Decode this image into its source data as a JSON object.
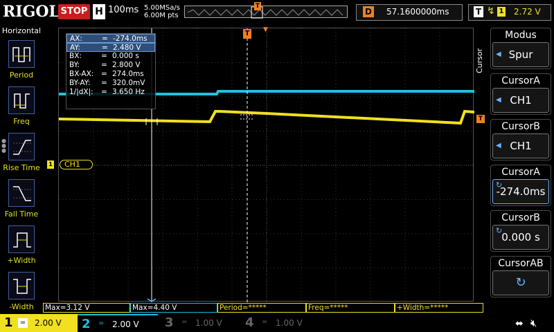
{
  "topbar": {
    "brand": "RIGOL",
    "run_state": "STOP",
    "timebase_label": "H",
    "timebase": "100ms",
    "sample_rate": "5.00MSa/s",
    "memory_depth": "6.00M pts",
    "trigger_pos_marker": "T",
    "delay_label": "D",
    "delay_value": "57.1600000ms",
    "trigger_label": "T",
    "trigger_edge_icon": "rising-edge-icon",
    "trigger_source": "1",
    "trigger_level": "2.72 V"
  },
  "left_panel": {
    "title": "Horizontal",
    "items": [
      {
        "label": "Period",
        "icon": "period-icon"
      },
      {
        "label": "Freq",
        "icon": "freq-icon"
      },
      {
        "label": "Rise Time",
        "icon": "rise-time-icon"
      },
      {
        "label": "Fall Time",
        "icon": "fall-time-icon"
      },
      {
        "label": "+Width",
        "icon": "positive-width-icon"
      },
      {
        "label": "-Width",
        "icon": "negative-width-icon"
      }
    ]
  },
  "cursor_table": {
    "rows": [
      {
        "key": "AX:",
        "value": "-274.0ms",
        "selected": true
      },
      {
        "key": "AY:",
        "value": "2.480 V",
        "selected": true
      },
      {
        "key": "BX:",
        "value": "0.000 s"
      },
      {
        "key": "BY:",
        "value": "2.800 V"
      },
      {
        "key": "BX-AX:",
        "value": "274.0ms"
      },
      {
        "key": "BY-AY:",
        "value": "320.0mV"
      },
      {
        "key": "1/|dX|:",
        "value": "3.650 Hz"
      }
    ],
    "equals": "="
  },
  "waveform": {
    "channel_label": "CH1",
    "channel_marker": "1",
    "trigger_level_marker": "T",
    "trigger_top_marker": "T",
    "ch1_color": "#f0e020",
    "ch2_color": "#20c0e0",
    "trigger_color": "#f08020"
  },
  "right_menu": {
    "vertical_label": "Cursor",
    "items": [
      {
        "title": "Modus",
        "value": "Spur"
      },
      {
        "title": "CursorA",
        "value": "CH1"
      },
      {
        "title": "CursorB",
        "value": "CH1"
      },
      {
        "title": "CursorA",
        "value": "-274.0ms"
      },
      {
        "title": "CursorB",
        "value": "0.000 s"
      },
      {
        "title": "CursorAB",
        "value": ""
      }
    ]
  },
  "measurements": [
    {
      "text": "Max=3.12 V"
    },
    {
      "text": "Max=4.40 V"
    },
    {
      "text": "Period=*****"
    },
    {
      "text": "Freq=*****"
    },
    {
      "text": "+Width=*****"
    }
  ],
  "channels": [
    {
      "num": "1",
      "coupling": "=",
      "scale": "2.00 V",
      "color": "#f0e020"
    },
    {
      "num": "2",
      "coupling": "=",
      "scale": "2.00 V",
      "color": "#20c0e0"
    },
    {
      "num": "3",
      "coupling": "=",
      "scale": "1.00 V",
      "color": "#c040c0"
    },
    {
      "num": "4",
      "coupling": "=",
      "scale": "1.00 V",
      "color": "#4060e0"
    }
  ],
  "status_icons": {
    "usb": "usb-icon",
    "speaker": "speaker-mute-icon"
  }
}
